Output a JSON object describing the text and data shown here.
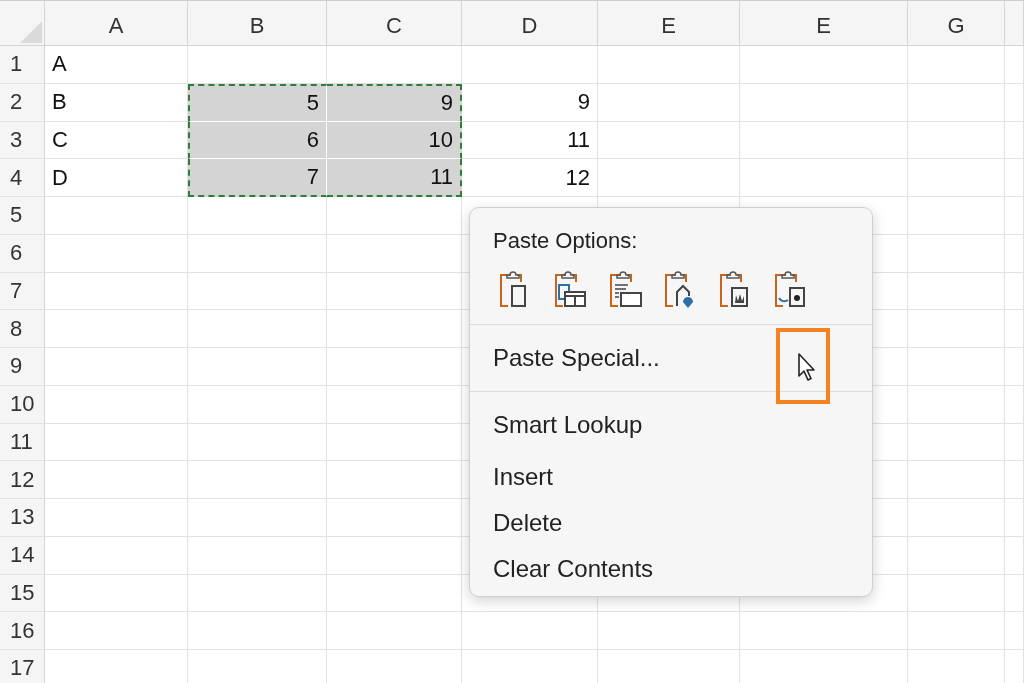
{
  "columns": [
    "A",
    "B",
    "C",
    "D",
    "E",
    "E",
    "G"
  ],
  "rows": [
    {
      "label": "1",
      "cells": [
        {
          "text": "A",
          "kind": "text",
          "selected": false
        },
        {
          "selected": false
        },
        {
          "selected": false
        },
        {
          "selected": false
        }
      ]
    },
    {
      "label": "2",
      "cells": [
        {
          "text": "B",
          "kind": "text",
          "selected": false
        },
        {
          "text": "5",
          "kind": "number",
          "selected": true
        },
        {
          "text": "9",
          "kind": "number",
          "selected": true
        },
        {
          "text": "9",
          "kind": "number",
          "selected": false
        }
      ]
    },
    {
      "label": "3",
      "cells": [
        {
          "text": "C",
          "kind": "text",
          "selected": false
        },
        {
          "text": "6",
          "kind": "number",
          "selected": true
        },
        {
          "text": "10",
          "kind": "number",
          "selected": true
        },
        {
          "text": "11",
          "kind": "number",
          "selected": false
        }
      ]
    },
    {
      "label": "4",
      "cells": [
        {
          "text": "D",
          "kind": "text",
          "selected": false
        },
        {
          "text": "7",
          "kind": "number",
          "selected": true
        },
        {
          "text": "11",
          "kind": "number",
          "selected": true
        },
        {
          "text": "12",
          "kind": "number",
          "selected": false
        }
      ]
    },
    {
      "label": "5"
    },
    {
      "label": "6"
    },
    {
      "label": "7"
    },
    {
      "label": "8"
    },
    {
      "label": "9"
    },
    {
      "label": "10"
    },
    {
      "label": "11"
    },
    {
      "label": "12"
    },
    {
      "label": "13"
    },
    {
      "label": "14"
    },
    {
      "label": "15"
    },
    {
      "label": "16"
    },
    {
      "label": "17"
    }
  ],
  "context_menu": {
    "title": "Paste Options:",
    "special": "Paste Special...",
    "items": [
      "Smart Lookup",
      "Insert",
      "Delete",
      "Clear Contents"
    ]
  }
}
